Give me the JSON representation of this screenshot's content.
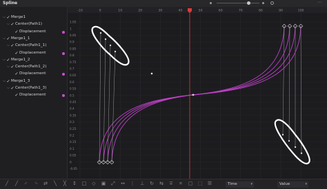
{
  "panel": {
    "title": "Spline"
  },
  "tree": [
    {
      "level": 0,
      "label": "Merge1",
      "expanded": true
    },
    {
      "level": 1,
      "label": "Center(Path1)",
      "expanded": true
    },
    {
      "level": 2,
      "label": "Displacement",
      "dot": true
    },
    {
      "level": 0,
      "label": "Merge1_1",
      "expanded": true
    },
    {
      "level": 1,
      "label": "Center(Path1_1)",
      "expanded": true
    },
    {
      "level": 2,
      "label": "Displacement",
      "dot": true
    },
    {
      "level": 0,
      "label": "Merge1_2",
      "expanded": true
    },
    {
      "level": 1,
      "label": "Center(Path1_2)",
      "expanded": true
    },
    {
      "level": 2,
      "label": "Displacement",
      "dot": true
    },
    {
      "level": 0,
      "label": "Merge1_3",
      "expanded": true
    },
    {
      "level": 1,
      "label": "Center(Path1_3)",
      "expanded": true
    },
    {
      "level": 2,
      "label": "Displacement",
      "dot": true
    }
  ],
  "ruler": {
    "labels": [
      "-10",
      "0",
      "10",
      "20",
      "30",
      "40",
      "50",
      "60",
      "70",
      "80",
      "90",
      "100"
    ]
  },
  "value_axis": {
    "labels": [
      "1.05",
      "1",
      "0.95",
      "0.9",
      "0.85",
      "0.8",
      "0.75",
      "0.7",
      "0.65",
      "0.6",
      "0.55",
      "0.5",
      "0.45",
      "0.4",
      "0.35",
      "0.3",
      "0.25",
      "0.2",
      "0.15",
      "0.1",
      "0.05",
      "0",
      "-0.05"
    ]
  },
  "curves": {
    "color": "#c040c8",
    "count": 4
  },
  "playhead": {
    "color": "#e03a3a"
  },
  "annotation": {
    "color": "#ffffff"
  },
  "bottom": {
    "time_label": "Time",
    "value_label": "Value",
    "tools": [
      "smooth-icon",
      "linear-icon",
      "step-in-icon",
      "step-out-icon",
      "reverse-icon",
      "ease-in-icon",
      "ease-out-icon",
      "time-stretch-icon",
      "shape-box-icon",
      "show-keys-icon",
      "select-all-icon",
      "zoom-fit-icon",
      "follow-icon",
      "key-markers-icon",
      "snap-icon",
      "loop-icon",
      "ping-pong-icon",
      "relative-icon",
      "grid-icon",
      "lock-icon",
      "fit-icon",
      "view-icon"
    ]
  }
}
